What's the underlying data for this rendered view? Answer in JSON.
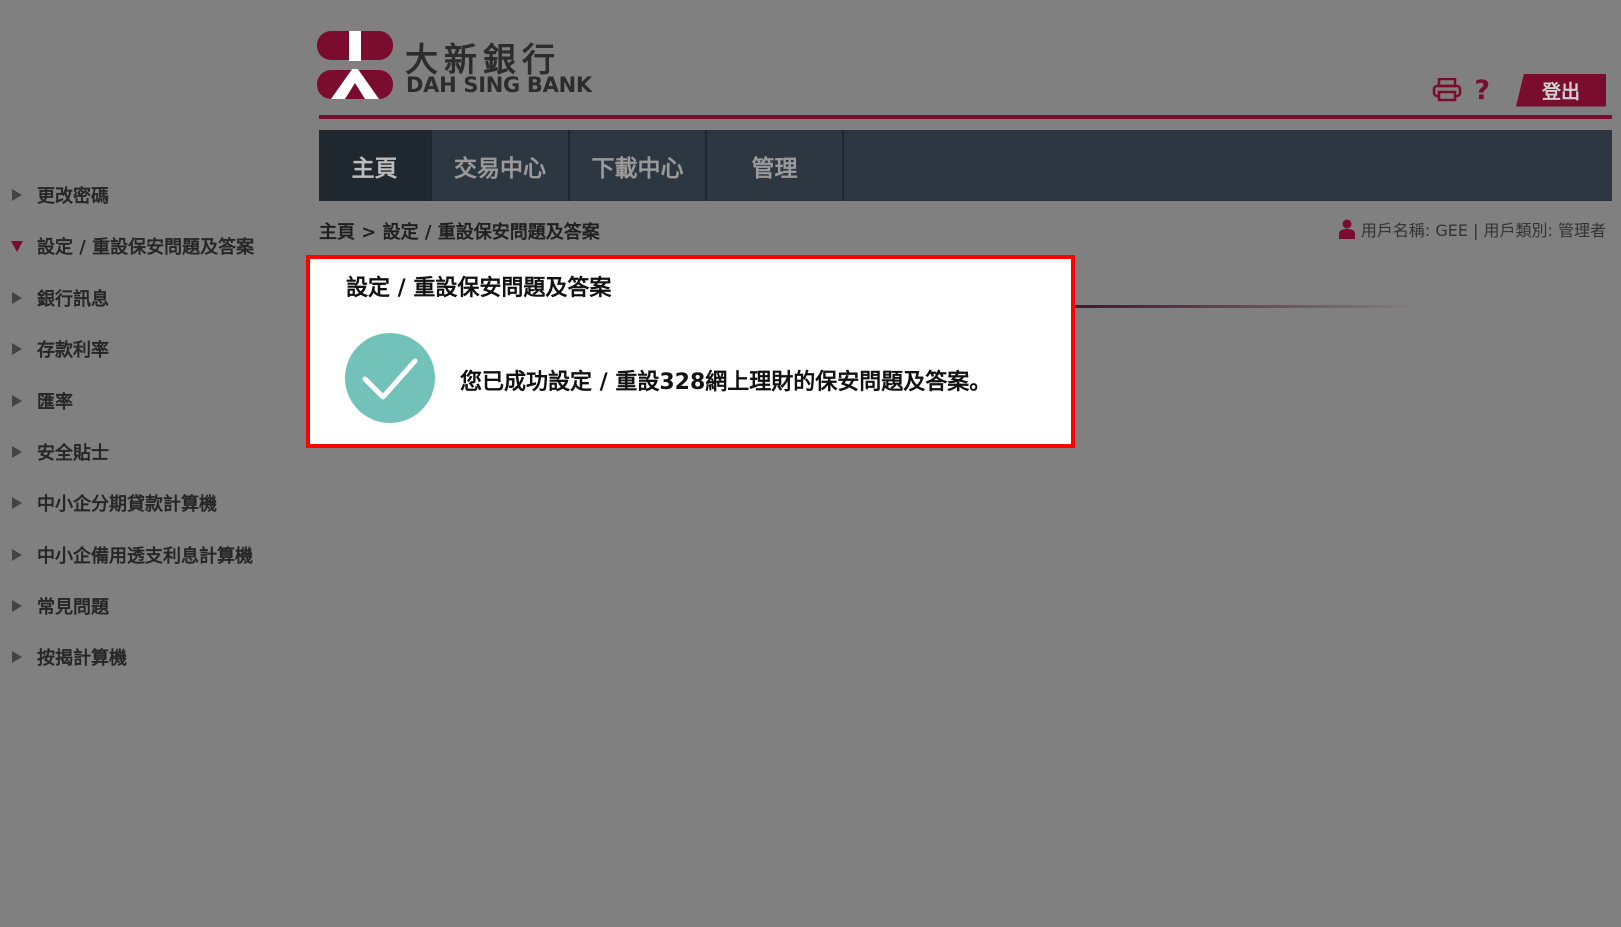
{
  "bank": {
    "name_cn": "大新銀行",
    "name_en": "DAH SING BANK",
    "brand_color": "#7a0d2e"
  },
  "header": {
    "print_icon": "printer-icon",
    "help_label": "?",
    "logout_label": "登出"
  },
  "nav": {
    "tabs": [
      {
        "label": "主頁",
        "active": true
      },
      {
        "label": "交易中心",
        "active": false
      },
      {
        "label": "下載中心",
        "active": false
      },
      {
        "label": "管理",
        "active": false
      }
    ]
  },
  "sidebar": {
    "items": [
      {
        "label": "更改密碼",
        "expanded": false
      },
      {
        "label": "設定 / 重設保安問題及答案",
        "expanded": true
      },
      {
        "label": "銀行訊息",
        "expanded": false
      },
      {
        "label": "存款利率",
        "expanded": false
      },
      {
        "label": "匯率",
        "expanded": false
      },
      {
        "label": "安全貼士",
        "expanded": false
      },
      {
        "label": "中小企分期貸款計算機",
        "expanded": false
      },
      {
        "label": "中小企備用透支利息計算機",
        "expanded": false
      },
      {
        "label": "常見問題",
        "expanded": false
      },
      {
        "label": "按揭計算機",
        "expanded": false
      }
    ]
  },
  "breadcrumb": "主頁 > 設定 / 重設保安問題及答案",
  "user": {
    "info": "用戶名稱: GEE | 用戶類別: 管理者"
  },
  "panel": {
    "title": "設定 / 重設保安問題及答案",
    "message": "您已成功設定 / 重設328網上理財的保安問題及答案。",
    "success_color": "#72c2b9"
  }
}
